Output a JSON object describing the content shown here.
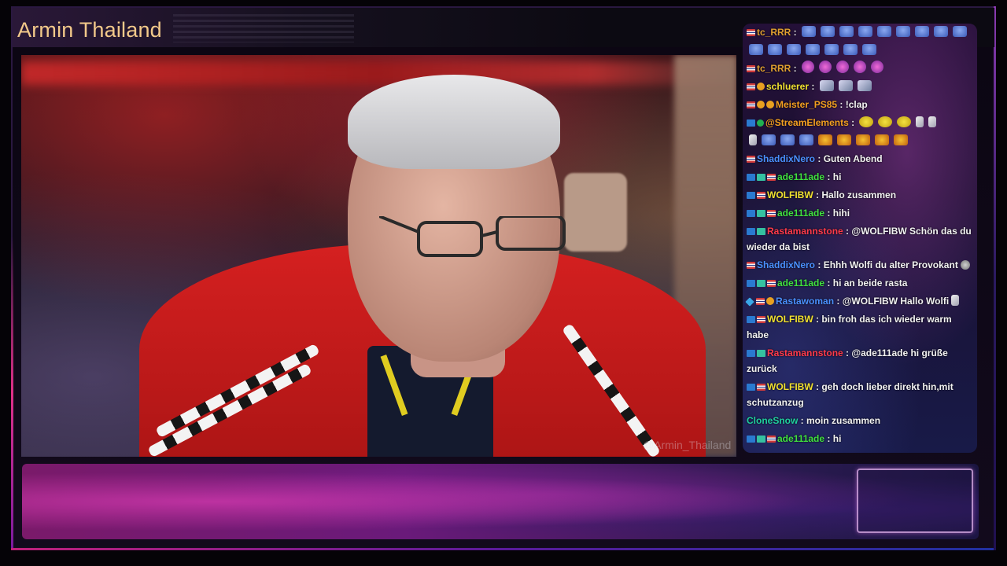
{
  "stream": {
    "channel_title": "Armin Thailand",
    "watermark": "@Armin_Thailand"
  },
  "chat": {
    "messages": [
      {
        "user": "tc_RRR",
        "color": "#e0a030",
        "sep": " : ",
        "text": "",
        "badges": [
          "flag"
        ],
        "emotes": [
          "cat",
          "cat",
          "cat",
          "cat",
          "cat",
          "cat",
          "cat",
          "cat",
          "cat"
        ]
      },
      {
        "user": "",
        "sep": "",
        "text": "",
        "badges": [],
        "emotes": [
          "cat",
          "cat",
          "cat",
          "cat",
          "cat",
          "cat",
          "cat"
        ]
      },
      {
        "user": "tc_RRR",
        "color": "#e0a030",
        "sep": " : ",
        "text": "",
        "badges": [
          "flag"
        ],
        "emotes": [
          "pink",
          "pink",
          "pink",
          "pink",
          "pink"
        ]
      },
      {
        "user": "schluerer",
        "color": "#f0e030",
        "sep": " : ",
        "text": "",
        "badges": [
          "flag",
          "bits"
        ],
        "emotes": [
          "hand",
          "hand",
          "hand"
        ]
      },
      {
        "user": "Meister_PS85",
        "color": "#f4a020",
        "sep": " : ",
        "text": "!clap",
        "badges": [
          "flag",
          "bits",
          "bits"
        ],
        "emotes": []
      },
      {
        "user": "@StreamElements",
        "color": "#f4a020",
        "sep": " : ",
        "text": "",
        "badges": [
          "prime",
          "mod"
        ],
        "emotes": [
          "yellow",
          "yellow",
          "yellow",
          "leaf",
          "leaf"
        ]
      },
      {
        "user": "",
        "sep": "",
        "text": "",
        "badges": [],
        "emotes": [
          "leaf",
          "cat",
          "cat",
          "cat",
          "fire",
          "fire",
          "fire",
          "fire",
          "fire"
        ]
      },
      {
        "user": "ShaddixNero",
        "color": "#4a90ff",
        "sep": " : ",
        "text": "Guten Abend",
        "badges": [
          "flag"
        ],
        "emotes": []
      },
      {
        "user": "ade111ade",
        "color": "#40e040",
        "sep": " : ",
        "text": "hi",
        "badges": [
          "prime",
          "sub",
          "flag"
        ],
        "emotes": []
      },
      {
        "user": "WOLFIBW",
        "color": "#f0e030",
        "sep": " : ",
        "text": "Hallo zusammen",
        "badges": [
          "prime",
          "flag"
        ],
        "emotes": []
      },
      {
        "user": "ade111ade",
        "color": "#40e040",
        "sep": " : ",
        "text": "hihi",
        "badges": [
          "prime",
          "sub",
          "flag"
        ],
        "emotes": []
      },
      {
        "user": "Rastamannstone",
        "color": "#ff3a4a",
        "sep": " : ",
        "text": "@WOLFIBW Schön das du wieder da bist",
        "badges": [
          "prime",
          "sub"
        ],
        "emotes": []
      },
      {
        "user": "ShaddixNero",
        "color": "#4a90ff",
        "sep": " : ",
        "text": "Ehhh Wolfi du alter Provokant",
        "badges": [
          "flag"
        ],
        "emotes": [
          "gray"
        ]
      },
      {
        "user": "ade111ade",
        "color": "#40e040",
        "sep": " : ",
        "text": "hi an beide rasta",
        "badges": [
          "prime",
          "sub",
          "flag"
        ],
        "emotes": []
      },
      {
        "user": "Rastawoman",
        "color": "#4a90ff",
        "sep": " : ",
        "text": "@WOLFIBW Hallo Wolfi",
        "badges": [
          "gem",
          "flag",
          "bits"
        ],
        "emotes": [
          "leaf"
        ]
      },
      {
        "user": "WOLFIBW",
        "color": "#f0e030",
        "sep": " : ",
        "text": "bin froh das ich wieder warm habe",
        "badges": [
          "prime",
          "flag"
        ],
        "emotes": []
      },
      {
        "user": "Rastamannstone",
        "color": "#ff3a4a",
        "sep": " : ",
        "text": "@ade111ade hi grüße zurück",
        "badges": [
          "prime",
          "sub"
        ],
        "emotes": []
      },
      {
        "user": "WOLFIBW",
        "color": "#f0e030",
        "sep": " : ",
        "text": "geh doch lieber direkt hin,mit schutzanzug",
        "badges": [
          "prime",
          "flag"
        ],
        "emotes": []
      },
      {
        "user": "CloneSnow",
        "color": "#20d0a0",
        "sep": " : ",
        "text": "moin zusammen",
        "badges": [],
        "emotes": []
      },
      {
        "user": "ade111ade",
        "color": "#40e040",
        "sep": " : ",
        "text": "hi",
        "badges": [
          "prime",
          "sub",
          "flag"
        ],
        "emotes": []
      }
    ]
  },
  "icons": {
    "badge_prime": "prime-badge-icon",
    "badge_flag": "flag-badge-icon",
    "badge_sub": "subscriber-badge-icon",
    "badge_bits": "bits-badge-icon",
    "badge_mod": "verified-badge-icon",
    "badge_gem": "gem-badge-icon"
  },
  "colors": {
    "title": "#f2c98a",
    "accent_pink": "#e0308a",
    "accent_purple": "#5a1a9a"
  }
}
